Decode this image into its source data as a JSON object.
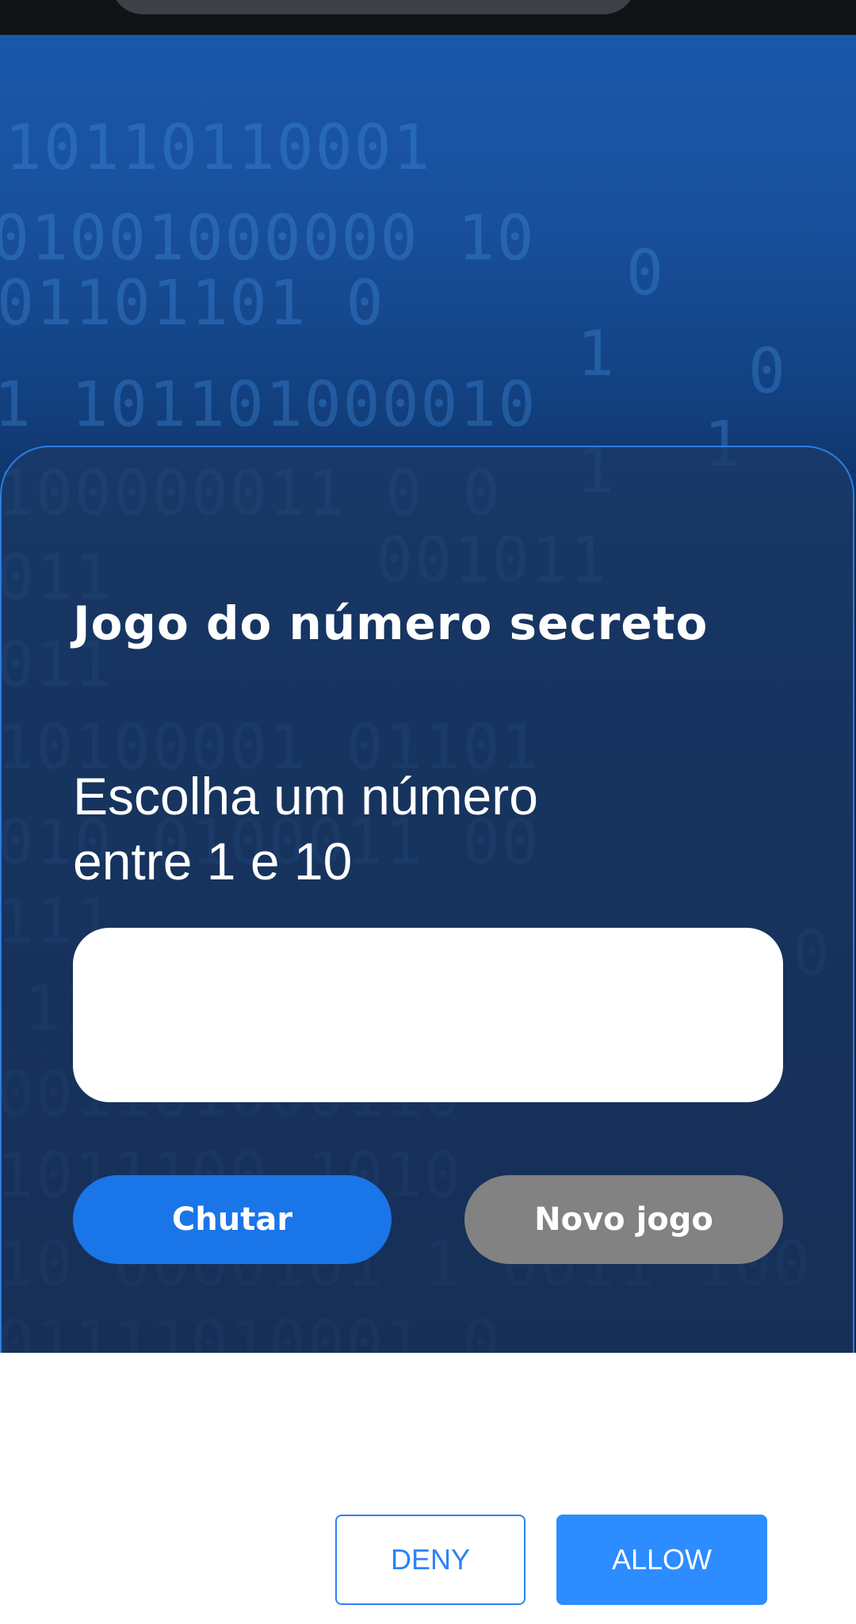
{
  "game": {
    "title": "Jogo do número secreto",
    "instruction": "Escolha um número entre 1 e 10",
    "input_value": "",
    "guess_button": "Chutar",
    "new_game_button": "Novo jogo"
  },
  "permission_dialog": {
    "deny_label": "DENY",
    "allow_label": "ALLOW"
  },
  "colors": {
    "primary_button": "#1a75e8",
    "disabled_button": "#828282",
    "allow_button": "#2d8cff",
    "card_border": "#2f7ce0"
  }
}
